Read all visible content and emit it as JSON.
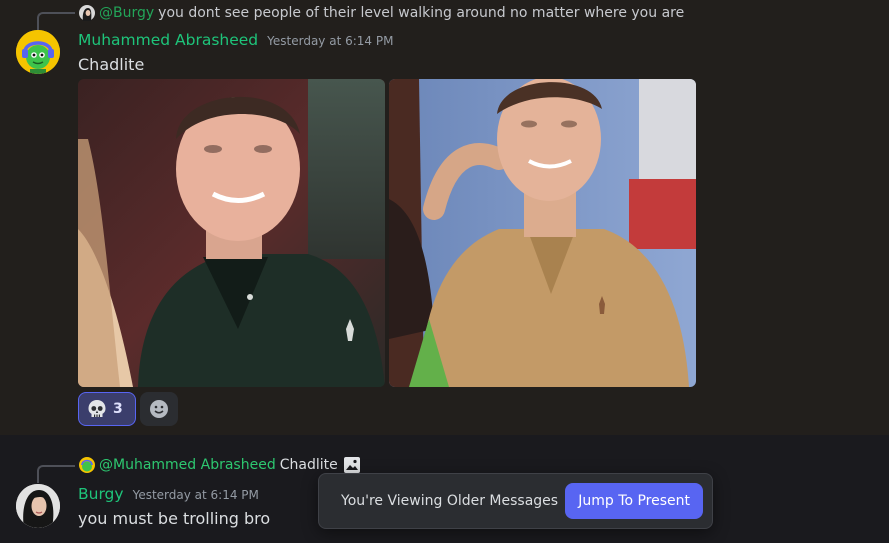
{
  "colors": {
    "chat_bg": "#1a1a1e",
    "highlight_bg": "#221f1c",
    "author_green": "#1ec47a",
    "mention_green": "#23a559",
    "accent": "#5865f2"
  },
  "messages": [
    {
      "reply": {
        "mention": "@Burgy",
        "text": "you dont see people of their level walking around no matter where you are"
      },
      "author": "Muhammed Abrasheed",
      "avatar_icon": "green-alien-headphones-avatar",
      "timestamp": "Yesterday at 6:14 PM",
      "content": "Chadlite",
      "attachments": [
        {
          "alt": "photo of young man in dark green polo shirt"
        },
        {
          "alt": "photo of young man in tan polo shirt"
        }
      ],
      "reactions": [
        {
          "emoji": "skull-icon",
          "count": "3",
          "active": true
        }
      ]
    },
    {
      "reply": {
        "mention": "@Muhammed Abrasheed",
        "text": "Chadlite",
        "attachment_icon": "image-icon"
      },
      "author": "Burgy",
      "avatar_icon": "dark-haired-woman-avatar",
      "timestamp": "Yesterday at 6:14 PM",
      "content": "you must be trolling bro"
    }
  ],
  "older_messages_bar": {
    "text": "You're Viewing Older Messages",
    "jump_label": "Jump To Present"
  }
}
